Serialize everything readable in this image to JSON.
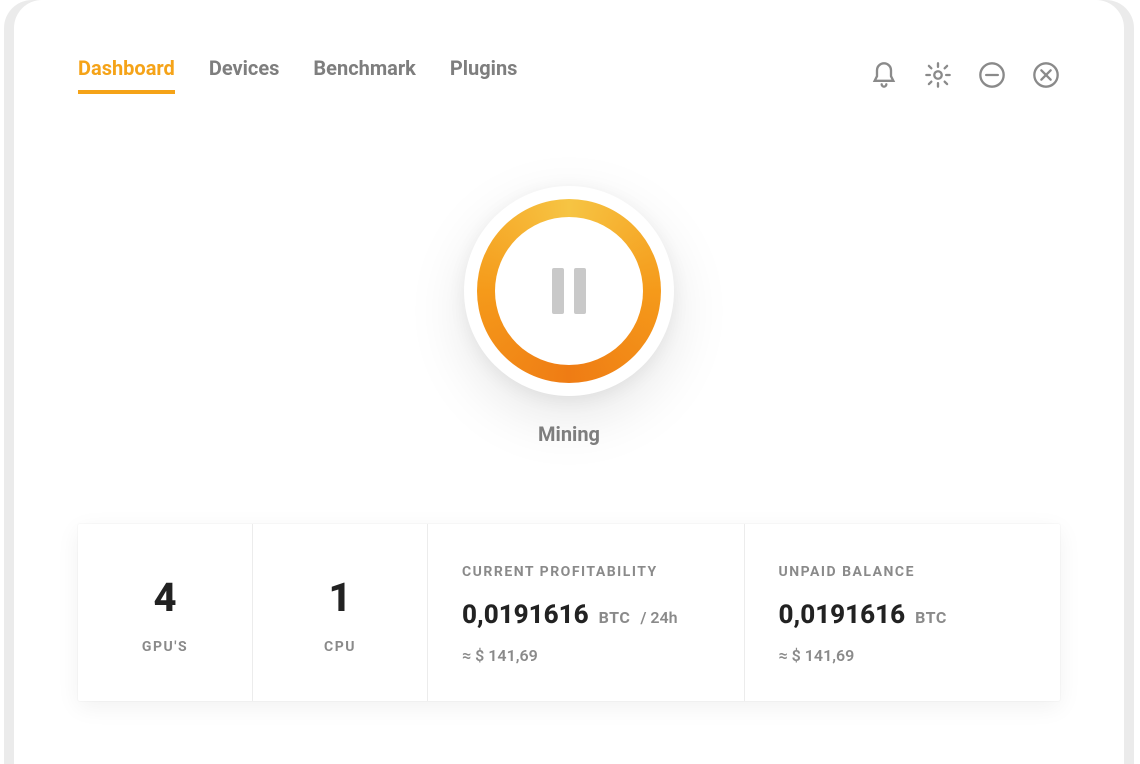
{
  "nav": {
    "tabs": [
      {
        "label": "Dashboard",
        "active": true
      },
      {
        "label": "Devices",
        "active": false
      },
      {
        "label": "Benchmark",
        "active": false
      },
      {
        "label": "Plugins",
        "active": false
      }
    ]
  },
  "mining": {
    "status_label": "Mining"
  },
  "stats": {
    "gpus": {
      "count": "4",
      "label": "GPU'S"
    },
    "cpu": {
      "count": "1",
      "label": "CPU"
    },
    "profitability": {
      "headline": "CURRENT PROFITABILITY",
      "value": "0,0191616",
      "unit": "BTC",
      "per": "/ 24h",
      "approx": "≈ $ 141,69"
    },
    "balance": {
      "headline": "UNPAID BALANCE",
      "value": "0,0191616",
      "unit": "BTC",
      "approx": "≈ $ 141,69"
    }
  },
  "colors": {
    "accent": "#f5a318"
  }
}
